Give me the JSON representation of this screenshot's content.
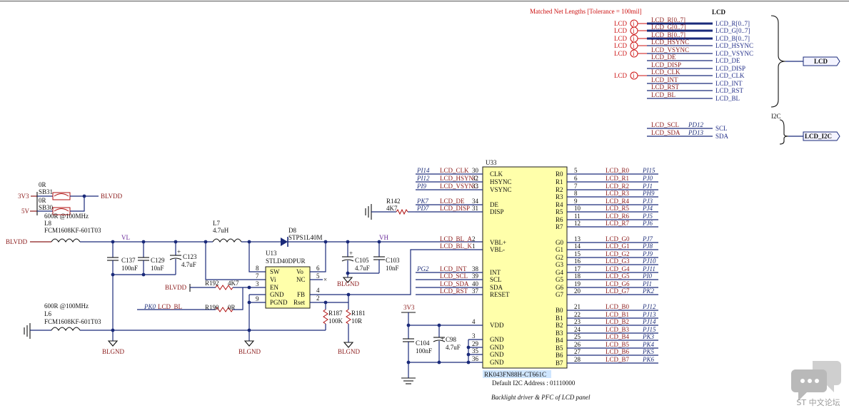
{
  "annotations": {
    "matched": "Matched Net Lengths [Tolerance = 100mil]",
    "lcd_heading": "LCD",
    "i2c_heading": "I2C",
    "title": "Backlight driver & PFC of LCD panel",
    "address": "Default I2C Address : 01110000"
  },
  "lcd_header": {
    "ports": [
      "LCD",
      "LCD_I2C"
    ],
    "prefix": "LCD",
    "nets": [
      "LCD_R[0..7]",
      "LCD_G[0..7]",
      "LCD_B[0..7]",
      "LCD_HSYNC",
      "LCD_VSYNC",
      "LCD_DE",
      "LCD_DISP",
      "LCD_CLK",
      "LCD_INT",
      "LCD_RST",
      "LCD_BL"
    ],
    "signals": [
      "LCD_R[0..7]",
      "LCD_G[0..7]",
      "LCD_B[0..7]",
      "LCD_HSYNC",
      "LCD_VSYNC",
      "LCD_DE",
      "LCD_DISP",
      "LCD_CLK",
      "LCD_INT",
      "LCD_RST",
      "LCD_BL"
    ],
    "i2c": [
      {
        "net": "LCD_SCL",
        "pin": "PD12",
        "sig": "SCL"
      },
      {
        "net": "LCD_SDA",
        "pin": "PD13",
        "sig": "SDA"
      }
    ]
  },
  "power": {
    "v33": "3V3",
    "v5": "5V",
    "blvdd": "BLVDD",
    "blgnd": "BLGND",
    "vl": "VL",
    "vh": "VH",
    "v33b": "3V3"
  },
  "parts": {
    "sb31": {
      "ref": "SB31",
      "val": "0R"
    },
    "sb30": {
      "ref": "SB30",
      "val": "0R"
    },
    "l8": {
      "ref": "L8",
      "val": "600R @100MHz",
      "part": "FCM1608KF-601T03"
    },
    "l6": {
      "ref": "L6",
      "val": "600R @100MHz",
      "part": "FCM1608KF-601T03"
    },
    "l7": {
      "ref": "L7",
      "val": "4.7uH"
    },
    "d8": {
      "ref": "D8",
      "val": "STPS1L40M"
    },
    "c137": {
      "ref": "C137",
      "val": "100nF"
    },
    "c129": {
      "ref": "C129",
      "val": "10nF"
    },
    "c123": {
      "ref": "C123",
      "val": "4.7uF"
    },
    "c105": {
      "ref": "C105",
      "val": "4.7uF"
    },
    "c103": {
      "ref": "C103",
      "val": "10nF"
    },
    "c104": {
      "ref": "C104",
      "val": "100nF"
    },
    "c98": {
      "ref": "C98",
      "val": "4.7uF"
    },
    "r192": {
      "ref": "R192",
      "val": "4K7"
    },
    "r190": {
      "ref": "R190",
      "val": "0R"
    },
    "r187": {
      "ref": "R187",
      "val": "100K"
    },
    "r181": {
      "ref": "R181",
      "val": "10R"
    },
    "r142": {
      "ref": "R142",
      "val": "4K7"
    },
    "u13": {
      "ref": "U13",
      "val": "STLD40DPUR",
      "pins": [
        "SW",
        "Vi",
        "EN",
        "GND",
        "PGND",
        "Vo",
        "NC",
        "FB",
        "Rset"
      ],
      "nums": [
        "8",
        "7",
        "3",
        "9",
        "6",
        "5",
        "4",
        "2"
      ],
      "nc": "×"
    },
    "u33": {
      "ref": "U33",
      "val": "RK043FN88H-CT661C"
    },
    "pk0": {
      "port": "PK0",
      "net": "LCD_BL"
    }
  },
  "u33_left": [
    {
      "port": "PI14",
      "net": "LCD_CLK",
      "num": "30",
      "pin": "CLK"
    },
    {
      "port": "PI12",
      "net": "LCD_HSYNC",
      "num": "32",
      "pin": "HSYNC"
    },
    {
      "port": "PI9",
      "net": "LCD_VSYNC",
      "num": "33",
      "pin": "VSYNC"
    },
    {
      "port": "PK7",
      "net": "LCD_DE",
      "num": "34",
      "pin": "DE"
    },
    {
      "port": "PD7",
      "net": "LCD_DISP",
      "num": "31",
      "pin": "DISP"
    },
    {
      "port": "",
      "net": "LCD_BL_A",
      "num": "2",
      "pin": "VBL+"
    },
    {
      "port": "",
      "net": "LCD_BL_K",
      "num": "1",
      "pin": "VBL-"
    },
    {
      "port": "PG2",
      "net": "LCD_INT",
      "num": "38",
      "pin": "INT"
    },
    {
      "port": "",
      "net": "LCD_SCL",
      "num": "39",
      "pin": "SCL"
    },
    {
      "port": "",
      "net": "LCD_SDA",
      "num": "40",
      "pin": "SDA"
    },
    {
      "port": "",
      "net": "LCD_RST",
      "num": "37",
      "pin": "RESET"
    },
    {
      "port": "",
      "net": "",
      "num": "4",
      "pin": "VDD"
    },
    {
      "port": "",
      "net": "",
      "num": "3",
      "pin": "GND"
    },
    {
      "port": "",
      "net": "",
      "num": "29",
      "pin": "GND"
    },
    {
      "port": "",
      "net": "",
      "num": "35",
      "pin": "GND"
    },
    {
      "port": "",
      "net": "",
      "num": "36",
      "pin": "GND"
    }
  ],
  "u33_right": [
    {
      "num": "5",
      "pin": "R0",
      "net": "LCD_R0",
      "port": "PI15"
    },
    {
      "num": "6",
      "pin": "R1",
      "net": "LCD_R1",
      "port": "PJ0"
    },
    {
      "num": "7",
      "pin": "R2",
      "net": "LCD_R2",
      "port": "PJ1"
    },
    {
      "num": "8",
      "pin": "R3",
      "net": "LCD_R3",
      "port": "PH9"
    },
    {
      "num": "9",
      "pin": "R4",
      "net": "LCD_R4",
      "port": "PJ3"
    },
    {
      "num": "10",
      "pin": "R5",
      "net": "LCD_R5",
      "port": "PJ4"
    },
    {
      "num": "11",
      "pin": "R6",
      "net": "LCD_R6",
      "port": "PJ5"
    },
    {
      "num": "12",
      "pin": "R7",
      "net": "LCD_R7",
      "port": "PJ6"
    },
    {
      "num": "13",
      "pin": "G0",
      "net": "LCD_G0",
      "port": "PJ7"
    },
    {
      "num": "14",
      "pin": "G1",
      "net": "LCD_G1",
      "port": "PJ8"
    },
    {
      "num": "15",
      "pin": "G2",
      "net": "LCD_G2",
      "port": "PJ9"
    },
    {
      "num": "16",
      "pin": "G3",
      "net": "LCD_G3",
      "port": "PJ10"
    },
    {
      "num": "17",
      "pin": "G4",
      "net": "LCD_G4",
      "port": "PJ11"
    },
    {
      "num": "18",
      "pin": "G5",
      "net": "LCD_G5",
      "port": "PI0"
    },
    {
      "num": "19",
      "pin": "G6",
      "net": "LCD_G6",
      "port": "PI1"
    },
    {
      "num": "20",
      "pin": "G7",
      "net": "LCD_G7",
      "port": "PK2"
    },
    {
      "num": "21",
      "pin": "B0",
      "net": "LCD_B0",
      "port": "PJ12"
    },
    {
      "num": "22",
      "pin": "B1",
      "net": "LCD_B1",
      "port": "PJ13"
    },
    {
      "num": "23",
      "pin": "B2",
      "net": "LCD_B2",
      "port": "PJ14"
    },
    {
      "num": "24",
      "pin": "B3",
      "net": "LCD_B3",
      "port": "PJ15"
    },
    {
      "num": "25",
      "pin": "B4",
      "net": "LCD_B4",
      "port": "PK3"
    },
    {
      "num": "26",
      "pin": "B5",
      "net": "LCD_B5",
      "port": "PK4"
    },
    {
      "num": "27",
      "pin": "B6",
      "net": "LCD_B6",
      "port": "PK5"
    },
    {
      "num": "28",
      "pin": "B7",
      "net": "LCD_B7",
      "port": "PK6"
    }
  ],
  "watermark": {
    "text": "ST 中文论坛",
    "icon": "chat-bubbles-icon"
  }
}
